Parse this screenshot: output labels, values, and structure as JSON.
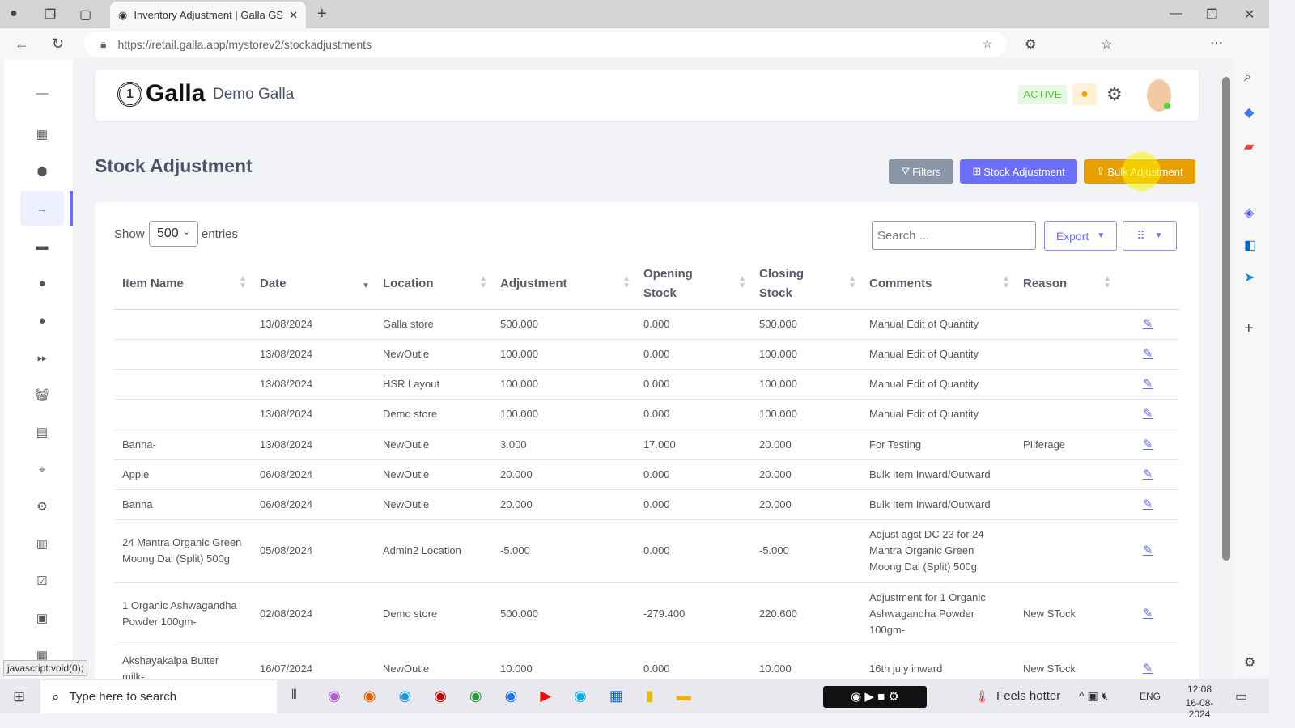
{
  "browser": {
    "tab_title": "Inventory Adjustment | Galla GST",
    "url": "https://retail.galla.app/mystorev2/stockadjustments",
    "status_text": "javascript:void(0);"
  },
  "header": {
    "brand": "Galla",
    "store": "Demo Galla",
    "status": "ACTIVE"
  },
  "page": {
    "title": "Stock Adjustment",
    "filters": "Filters",
    "stock_adjustment": "Stock Adjustment",
    "bulk_adjustment": "Bulk Adjustment"
  },
  "controls": {
    "show": "Show",
    "entries_value": "500",
    "entries": "entries",
    "search_placeholder": "Search ...",
    "export": "Export"
  },
  "table": {
    "columns": [
      "Item Name",
      "Date",
      "Location",
      "Adjustment",
      "Opening Stock",
      "Closing Stock",
      "Comments",
      "Reason"
    ],
    "rows": [
      [
        "",
        "13/08/2024",
        "Galla store",
        "500.000",
        "0.000",
        "500.000",
        "Manual Edit of Quantity",
        ""
      ],
      [
        "",
        "13/08/2024",
        "NewOutle",
        "100.000",
        "0.000",
        "100.000",
        "Manual Edit of Quantity",
        ""
      ],
      [
        "",
        "13/08/2024",
        "HSR Layout",
        "100.000",
        "0.000",
        "100.000",
        "Manual Edit of Quantity",
        ""
      ],
      [
        "",
        "13/08/2024",
        "Demo store",
        "100.000",
        "0.000",
        "100.000",
        "Manual Edit of Quantity",
        ""
      ],
      [
        "Banna-",
        "13/08/2024",
        "NewOutle",
        "3.000",
        "17.000",
        "20.000",
        "For Testing",
        "PIlferage"
      ],
      [
        "Apple",
        "06/08/2024",
        "NewOutle",
        "20.000",
        "0.000",
        "20.000",
        "Bulk Item Inward/Outward",
        ""
      ],
      [
        "Banna",
        "06/08/2024",
        "NewOutle",
        "20.000",
        "0.000",
        "20.000",
        "Bulk Item Inward/Outward",
        ""
      ],
      [
        "24 Mantra Organic Green Moong Dal (Split) 500g",
        "05/08/2024",
        "Admin2 Location",
        "-5.000",
        "0.000",
        "-5.000",
        "Adjust agst DC 23 for 24 Mantra Organic Green Moong Dal (Split) 500g",
        ""
      ],
      [
        "1 Organic Ashwagandha Powder 100gm-",
        "02/08/2024",
        "Demo store",
        "500.000",
        "-279.400",
        "220.600",
        "Adjustment for 1 Organic Ashwagandha Powder 100gm-",
        "New STock"
      ],
      [
        "Akshayakalpa Butter milk-",
        "16/07/2024",
        "NewOutle",
        "10.000",
        "0.000",
        "10.000",
        "16th july inward",
        "New STock"
      ]
    ]
  },
  "taskbar": {
    "search": "Type here to search",
    "weather": "Feels hotter",
    "lang": "ENG",
    "time": "12:08",
    "date": "16-08-2024"
  },
  "colors": {
    "primary": "#6b6ef9",
    "warning": "#e8a000",
    "filters": "#8a95a5",
    "active_bg": "#e6f9e3",
    "active_text": "#58c43f"
  }
}
